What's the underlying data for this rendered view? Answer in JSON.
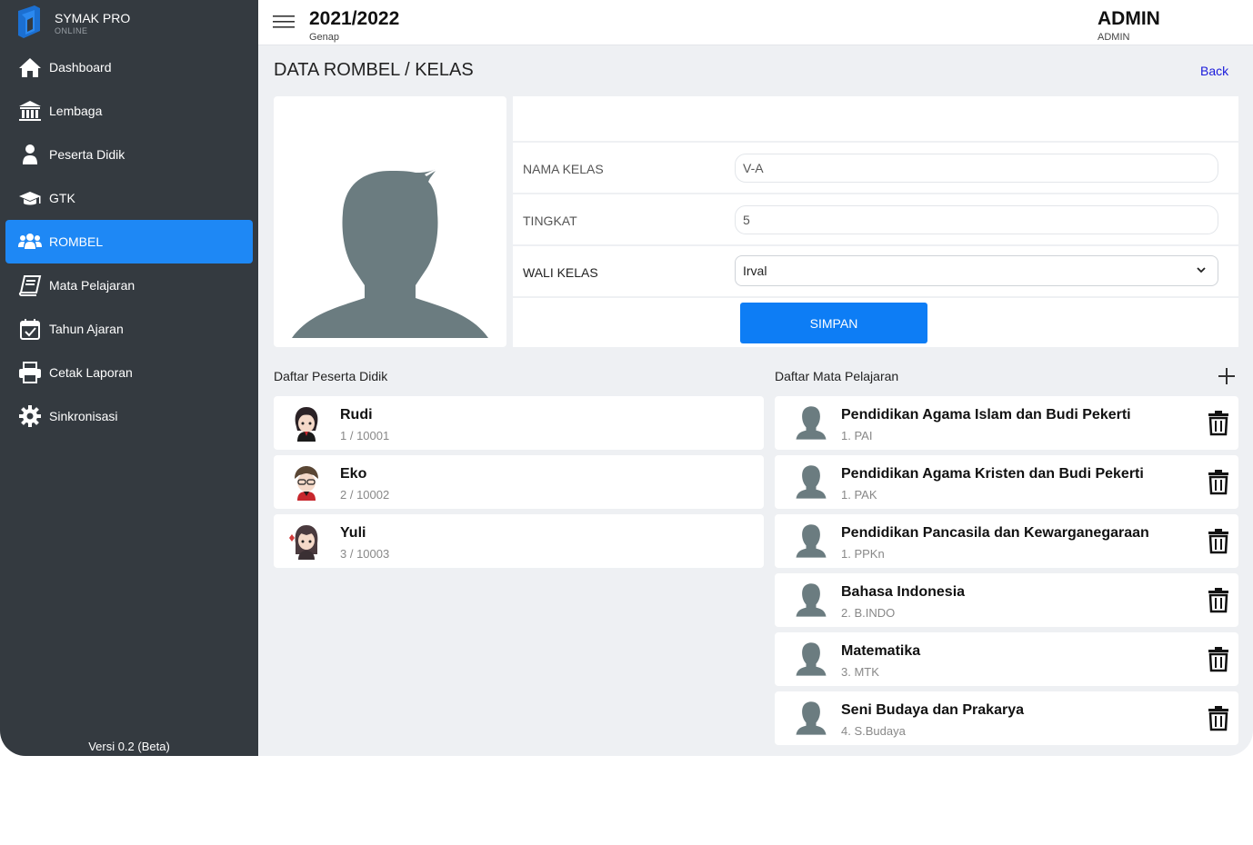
{
  "app": {
    "name": "SYMAK PRO",
    "status": "ONLINE",
    "version": "Versi 0.2 (Beta)"
  },
  "sidebar": {
    "items": [
      {
        "label": "Dashboard",
        "icon": "home-icon",
        "active": false
      },
      {
        "label": "Lembaga",
        "icon": "institution-icon",
        "active": false
      },
      {
        "label": "Peserta Didik",
        "icon": "user-icon",
        "active": false
      },
      {
        "label": "GTK",
        "icon": "graduation-cap-icon",
        "active": false
      },
      {
        "label": "ROMBEL",
        "icon": "users-icon",
        "active": true
      },
      {
        "label": "Mata Pelajaran",
        "icon": "book-icon",
        "active": false
      },
      {
        "label": "Tahun Ajaran",
        "icon": "calendar-check-icon",
        "active": false
      },
      {
        "label": "Cetak Laporan",
        "icon": "printer-icon",
        "active": false
      },
      {
        "label": "Sinkronisasi",
        "icon": "gear-icon",
        "active": false
      }
    ]
  },
  "header": {
    "year": "2021/2022",
    "semester": "Genap",
    "user_name": "ADMIN",
    "user_role": "ADMIN"
  },
  "page": {
    "title": "DATA ROMBEL / KELAS",
    "back_label": "Back"
  },
  "form": {
    "nama_kelas_label": "NAMA KELAS",
    "nama_kelas_value": "V-A",
    "tingkat_label": "TINGKAT",
    "tingkat_value": "5",
    "wali_kelas_label": "WALI KELAS",
    "wali_kelas_value": "Irval",
    "save_label": "SIMPAN"
  },
  "students": {
    "title": "Daftar Peserta Didik",
    "items": [
      {
        "name": "Rudi",
        "sub": "1 / 10001"
      },
      {
        "name": "Eko",
        "sub": "2 / 10002"
      },
      {
        "name": "Yuli",
        "sub": "3 / 10003"
      }
    ]
  },
  "subjects": {
    "title": "Daftar Mata Pelajaran",
    "items": [
      {
        "name": "Pendidikan Agama Islam dan Budi Pekerti",
        "sub": "1. PAI"
      },
      {
        "name": "Pendidikan Agama Kristen dan Budi Pekerti",
        "sub": "1. PAK"
      },
      {
        "name": "Pendidikan Pancasila dan Kewarganegaraan",
        "sub": "1. PPKn"
      },
      {
        "name": "Bahasa Indonesia",
        "sub": "2. B.INDO"
      },
      {
        "name": "Matematika",
        "sub": "3. MTK"
      },
      {
        "name": "Seni Budaya dan Prakarya",
        "sub": "4. S.Budaya"
      }
    ]
  },
  "colors": {
    "sidebar_bg": "#343a40",
    "accent": "#1e88f5",
    "button": "#0d7df5",
    "silhouette": "#6b7c80"
  }
}
